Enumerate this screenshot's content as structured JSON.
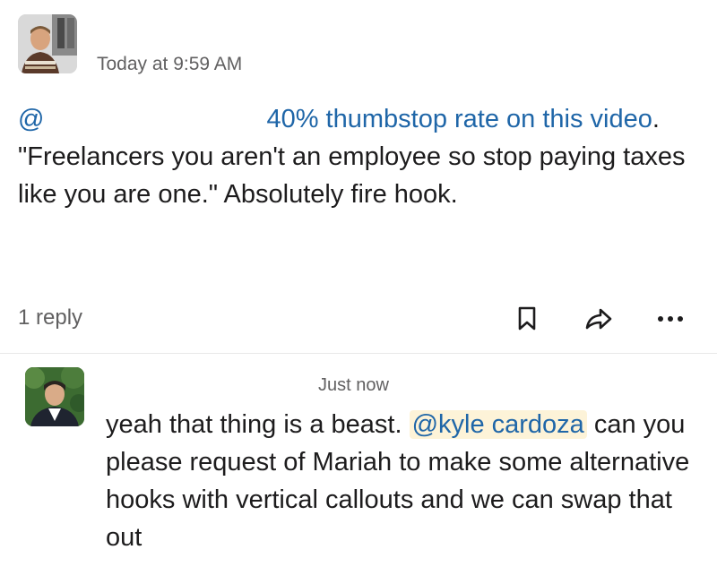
{
  "message": {
    "timestamp": "Today at 9:59 AM",
    "mention_prefix": "@",
    "text_blue": "40% thumbstop rate on this video",
    "text_rest": ". \"Freelancers you aren't an employee so stop paying taxes like you are one.\" Absolutely fire hook.",
    "reply_count": "1 reply",
    "actions": {
      "bookmark_icon": "bookmark-icon",
      "share_icon": "share-arrow-icon",
      "more_icon": "more-horizontal-icon"
    }
  },
  "reply": {
    "timestamp": "Just now",
    "text_before": "yeah that thing is a beast. ",
    "mention": "@kyle cardoza",
    "text_after": " can you please request of Mariah to make some alternative hooks with vertical callouts and we can swap that out"
  },
  "colors": {
    "link": "#1f66a8",
    "mention_bg": "#fdf3d8",
    "muted_text": "#616061",
    "body_text": "#1d1c1d"
  }
}
